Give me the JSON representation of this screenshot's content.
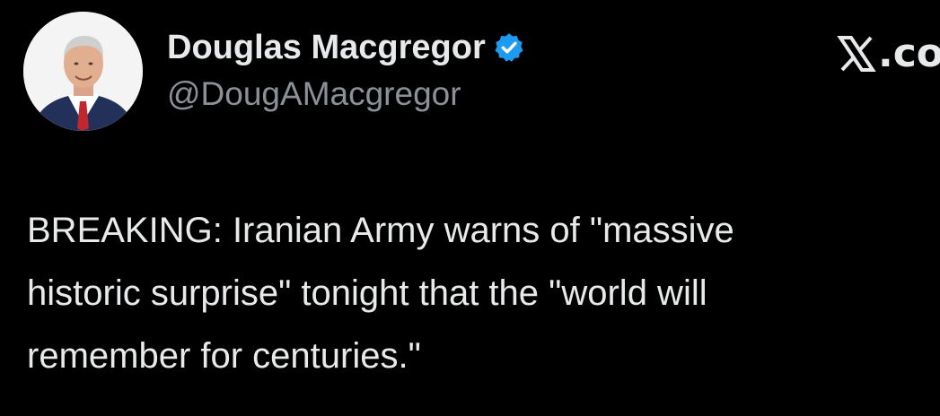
{
  "tweet": {
    "author": {
      "display_name": "Douglas Macgregor",
      "handle": "@DougAMacgregor",
      "verified": true,
      "avatar": "profile-photo"
    },
    "brand": {
      "text": ".co"
    },
    "text": "BREAKING: Iranian Army warns of \"massive\nhistoric surprise\" tonight that the \"world will\nremember for centuries.\""
  },
  "colors": {
    "background": "#000000",
    "text": "#e7e9ea",
    "secondary_text": "#8b9197",
    "verified_badge": "#1d9bf0"
  }
}
